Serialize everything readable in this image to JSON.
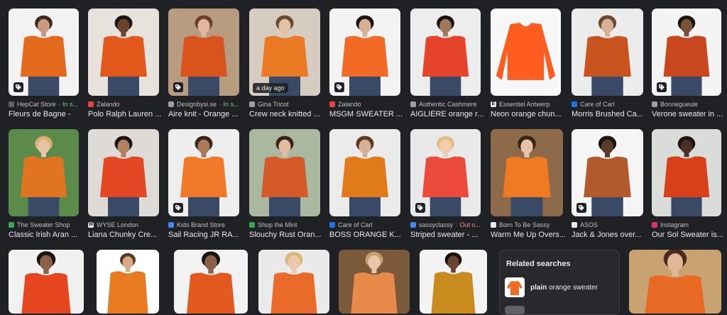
{
  "row1": [
    {
      "source": "HepCat Store",
      "extra": " · In s...",
      "extra_kind": "stock",
      "title": "Fleurs de Bagne -",
      "tag": true,
      "bg": "#f2f2f2",
      "sweater": "#e36a1d",
      "skin": "#c99a80",
      "hair": "#3a2a20",
      "fav": "#5f6368"
    },
    {
      "source": "Zalando",
      "extra": "",
      "title": "Polo Ralph Lauren ...",
      "tag": false,
      "bg": "#e7e2dc",
      "sweater": "#e2581b",
      "skin": "#6b4430",
      "hair": "#1c1410",
      "fav": "#ea4335"
    },
    {
      "source": "Designbysi.se",
      "extra": " · In s...",
      "extra_kind": "stock",
      "title": "Aire knit - Orange ...",
      "tag": true,
      "bg": "#b89c80",
      "sweater": "#d9531c",
      "skin": "#e0b8a0",
      "hair": "#6a4028",
      "fav": "#9aa0a6"
    },
    {
      "source": "Gina Tricot",
      "extra": "",
      "title": "Crew neck knitted ...",
      "tag": false,
      "badge": "a day ago",
      "bg": "#d6ccc2",
      "sweater": "#ea7a24",
      "skin": "#e4c0a6",
      "hair": "#6b4a30",
      "fav": "#9aa0a6"
    },
    {
      "source": "Zalando",
      "extra": "",
      "title": "MSGM SWEATER ...",
      "tag": true,
      "bg": "#f3f3f3",
      "sweater": "#f26a25",
      "skin": "#d8b094",
      "hair": "#1c1410",
      "fav": "#ea4335"
    },
    {
      "source": "Authentic Cashmere",
      "extra": "",
      "title": "AIGLIÈRE orange r...",
      "tag": false,
      "bg": "#ededed",
      "sweater": "#e5432a",
      "skin": "#a0785c",
      "hair": "#1a1410",
      "fav": "#9aa0a6"
    },
    {
      "source": "Essentiel Antwerp",
      "extra": "",
      "title": "Neon orange chun...",
      "tag": false,
      "bg": "#f7f7f7",
      "sweater": "#ff5d20",
      "skin": "",
      "hair": "",
      "fav": "#e8eaed",
      "fav_letter": "E"
    },
    {
      "source": "Care of Carl",
      "extra": "",
      "title": "Morris Brushed Ca...",
      "tag": false,
      "bg": "#ececec",
      "sweater": "#c8531f",
      "skin": "#d9b094",
      "hair": "#6b4a30",
      "fav": "#1a73e8"
    },
    {
      "source": "Bonnegueule",
      "extra": "",
      "title": "Verone sweater in ...",
      "tag": true,
      "bg": "#f4f4f4",
      "sweater": "#c9471f",
      "skin": "#7a5038",
      "hair": "#1a1410",
      "fav": "#9aa0a6"
    }
  ],
  "row2": [
    {
      "source": "The Sweater Shop",
      "extra": "",
      "title": "Classic Irish Aran ...",
      "tag": false,
      "bg": "#5b8a4a",
      "sweater": "#e07420",
      "skin": "#e8c4a6",
      "hair": "#d8b070",
      "fav": "#34a853"
    },
    {
      "source": "WYSE London",
      "extra": "",
      "title": "Liana Chunky Cre...",
      "tag": false,
      "bg": "#dedad6",
      "sweater": "#e34724",
      "skin": "#b08060",
      "hair": "#1c1410",
      "fav": "#e8eaed",
      "fav_letter": "W"
    },
    {
      "source": "Kids Brand Store",
      "extra": "",
      "title": "Sail Racing JR RA...",
      "tag": true,
      "bg": "#eeeeee",
      "sweater": "#f07a2a",
      "skin": "#a67a5a",
      "hair": "#3a2418",
      "fav": "#4285f4"
    },
    {
      "source": "Shop the Mint",
      "extra": "",
      "title": "Slouchy Rust Oran...",
      "tag": false,
      "bg": "#a9b89e",
      "sweater": "#d45a2a",
      "skin": "#e0bca2",
      "hair": "#3a2418",
      "fav": "#34a853"
    },
    {
      "source": "Care of Carl",
      "extra": "",
      "title": "BOSS ORANGE K...",
      "tag": false,
      "bg": "#ebebeb",
      "sweater": "#e07a1a",
      "skin": "#d8b094",
      "hair": "#5a3a20",
      "fav": "#1a73e8"
    },
    {
      "source": "sassyclassy",
      "extra": " · Out o...",
      "extra_kind": "oos",
      "title": "Striped sweater - ...",
      "tag": true,
      "bg": "#e9e9e9",
      "sweater": "#ec4a3a",
      "skin": "#f0ccb0",
      "hair": "#e0c080",
      "fav": "#4285f4"
    },
    {
      "source": "Born To Be Sassy",
      "extra": "",
      "title": "Warm Me Up Overs...",
      "tag": false,
      "bg": "#8c6a4a",
      "sweater": "#f07a22",
      "skin": "#e8c4a6",
      "hair": "#3a2418",
      "fav": "#e8eaed"
    },
    {
      "source": "ASOS",
      "extra": "",
      "title": "Jack & Jones over...",
      "tag": true,
      "bg": "#f5f5f5",
      "sweater": "#b25a2e",
      "skin": "#5a3a28",
      "hair": "#1a1410",
      "fav": "#e8eaed"
    },
    {
      "source": "Instagram",
      "extra": "",
      "title": "Our Sol Sweater is...",
      "tag": false,
      "bg": "#d9dcd8",
      "sweater": "#d8401a",
      "skin": "#4a3024",
      "hair": "#1a1410",
      "fav": "#e1306c"
    }
  ],
  "row3": [
    {
      "bg": "#f1f1f1",
      "sweater": "#e5461f",
      "skin": "#8a6046",
      "hair": "#1a1410"
    },
    {
      "bg": "#ffffff",
      "sweater": "#e87a22",
      "skin": "#d8a888",
      "hair": "#5a3a24"
    },
    {
      "bg": "#f2f2f2",
      "sweater": "#e35a1e",
      "skin": "#8a6046",
      "hair": "#1a1410"
    },
    {
      "bg": "#eaeaea",
      "sweater": "#ea6a2a",
      "skin": "#ecc8ac",
      "hair": "#d8b878"
    },
    {
      "bg": "#7a5a3a",
      "sweater": "#e88a4a",
      "skin": "#eac6aa",
      "hair": "#c8a070"
    },
    {
      "bg": "#f3f3f3",
      "sweater": "#c98a1e",
      "skin": "#6a4430",
      "hair": "#1a1410"
    },
    {
      "bg": "#c8a270",
      "sweater": "#e86a24",
      "skin": "#e0b898",
      "hair": "#4a2a1a"
    }
  ],
  "related": {
    "heading": "Related searches",
    "item_bold": "plain",
    "item_rest": " orange sweater"
  }
}
